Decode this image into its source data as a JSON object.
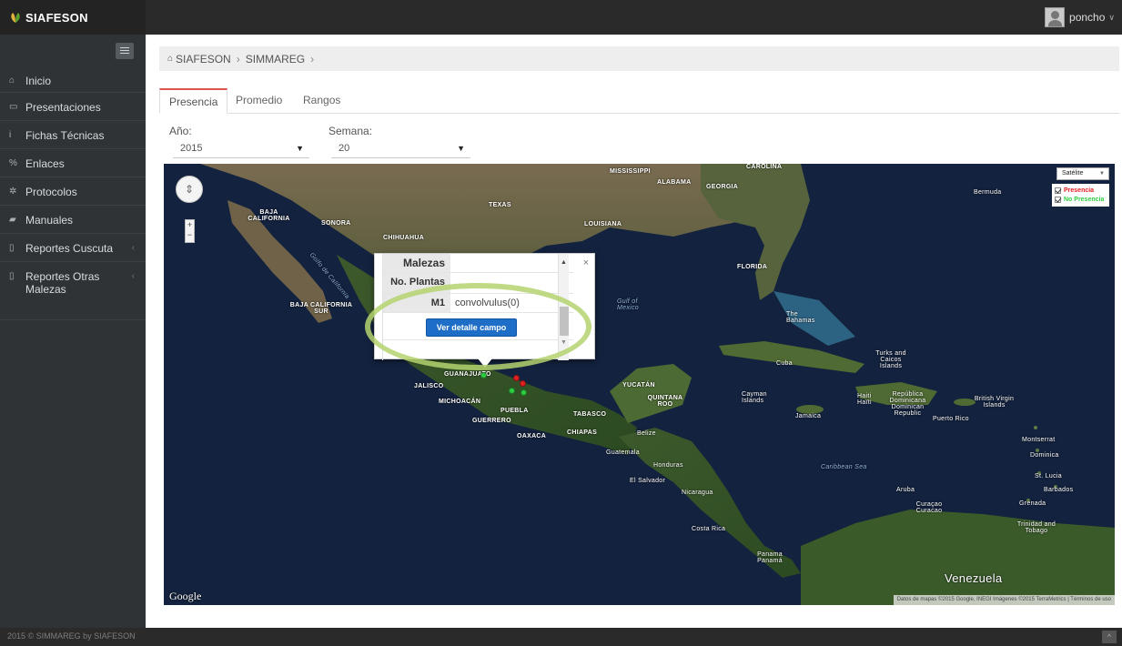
{
  "app": {
    "brand": "SIAFESON",
    "user": "poncho",
    "colors": {
      "accent_tab": "#d9534f",
      "brand_leaf": "#e2b33b",
      "presence": "#e02020",
      "no_presence": "#2ecc40",
      "button": "#1e6ec8"
    }
  },
  "sidebar": {
    "items": [
      {
        "icon": "home-icon",
        "label": "Inicio"
      },
      {
        "icon": "folder-icon",
        "label": "Presentaciones"
      },
      {
        "icon": "info-icon",
        "label": "Fichas Técnicas"
      },
      {
        "icon": "link-icon",
        "label": "Enlaces"
      },
      {
        "icon": "gear-icon",
        "label": "Protocolos"
      },
      {
        "icon": "book-icon",
        "label": "Manuales"
      },
      {
        "icon": "file-icon",
        "label": "Reportes Cuscuta"
      },
      {
        "icon": "file-icon",
        "label": "Reportes Otras Malezas"
      }
    ]
  },
  "breadcrumb": {
    "items": [
      "SIAFESON",
      "SIMMAREG"
    ]
  },
  "tabs": [
    "Presencia",
    "Promedio",
    "Rangos"
  ],
  "filters": {
    "year_label": "Año:",
    "year_value": "2015",
    "week_label": "Semana:",
    "week_value": "20"
  },
  "map": {
    "type_select": "Satélite",
    "legend": {
      "presence": "Presencia",
      "no_presence": "No Presencia"
    },
    "logo": "Google",
    "attribution": "Datos de mapas ©2015 Google, INEGI Imágenes ©2015 TerraMetrics | Términos de uso",
    "labels": {
      "mississippi": "MISSISSIPPI",
      "alabama": "ALABAMA",
      "georgia": "GEORGIA",
      "carolina": "CAROLINA",
      "texas": "TEXAS",
      "louisiana": "LOUISIANA",
      "florida": "FLORIDA",
      "baja_california": "BAJA CALIFORNIA",
      "sonora": "SONORA",
      "chihuahua": "CHIHUAHUA",
      "baja_california_sur": "BAJA CALIFORNIA SUR",
      "gulf_california": "Golfo de California",
      "gulf_mexico": "Gulf of Mexico",
      "bermuda": "Bermuda",
      "bahamas": "The Bahamas",
      "cuba": "Cuba",
      "turks": "Turks and Caicos Islands",
      "guanajuato": "GUANAJUATO",
      "jalisco": "JALISCO",
      "michoacan": "MICHOACÁN",
      "puebla": "PUEBLA",
      "guerrero": "GUERRERO",
      "oaxaca": "OAXACA",
      "chiapas": "CHIAPAS",
      "tabasco": "TABASCO",
      "yucatan": "YUCATÁN",
      "quintana_roo": "QUINTANA ROO",
      "belize": "Belize",
      "guatemala": "Guatemala",
      "honduras": "Honduras",
      "el_salvador": "El Salvador",
      "nicaragua": "Nicaragua",
      "costa_rica": "Costa Rica",
      "panama": "Panama Panamá",
      "cayman": "Cayman Islands",
      "jamaica": "Jamaica",
      "haiti": "Haiti Haïti",
      "dominican": "República Dominicana Dominican Republic",
      "puerto_rico": "Puerto Rico",
      "bvi": "British Virgin Islands",
      "montserrat": "Montserrat",
      "dominica": "Dominica",
      "st_lucia": "St. Lucia",
      "barbados": "Barbados",
      "grenada": "Grenada",
      "aruba": "Aruba",
      "curacao": "Curaçao Curacao",
      "trinidad": "Trinidad and Tobago",
      "caribbean_sea": "Caribbean Sea",
      "venezuela": "Venezuela"
    },
    "infowindow": {
      "header_key": "Malezas",
      "plants_key": "No. Plantas",
      "m1_key": "M1",
      "m1_value": "convolvulus(0)",
      "button": "Ver detalle campo"
    }
  },
  "footer": {
    "text": "2015 © SIMMAREG by SIAFESON"
  }
}
